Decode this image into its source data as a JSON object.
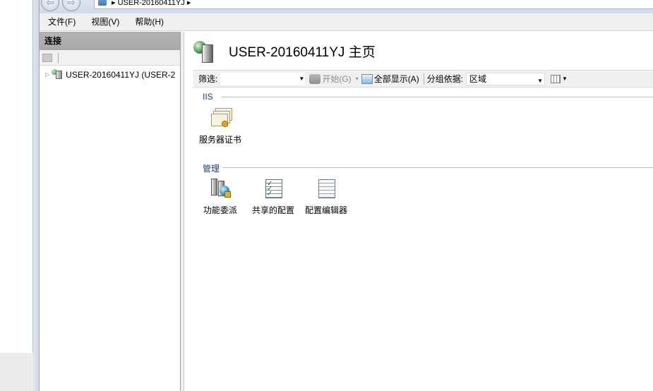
{
  "address_bar": {
    "path": "▸ USER-20160411YJ ▸"
  },
  "menu": {
    "items": [
      "文件(F)",
      "视图(V)",
      "帮助(H)"
    ]
  },
  "connections": {
    "header": "连接",
    "tree": [
      {
        "label": "USER-20160411YJ (USER-2",
        "icon": "server-icon",
        "expanded": false
      }
    ]
  },
  "main": {
    "title": "USER-20160411YJ 主页",
    "filter": {
      "label": "筛选:",
      "value": "",
      "start_label": "开始(G)",
      "show_all_label": "全部显示(A)",
      "group_label": "分组依据:",
      "group_value": "区域"
    },
    "sections": [
      {
        "label": "IIS",
        "features": [
          {
            "label": "服务器证书",
            "icon": "server-certificates-icon"
          }
        ]
      },
      {
        "label": "管理",
        "features": [
          {
            "label": "功能委派",
            "icon": "feature-delegation-icon"
          },
          {
            "label": "共享的配置",
            "icon": "shared-configuration-icon"
          },
          {
            "label": "配置编辑器",
            "icon": "configuration-editor-icon"
          }
        ]
      }
    ]
  },
  "colors": {
    "section_label": "#1f3f73",
    "pane_header": "#b3b3b3",
    "toolbar_bg": "#f0f0f0"
  }
}
